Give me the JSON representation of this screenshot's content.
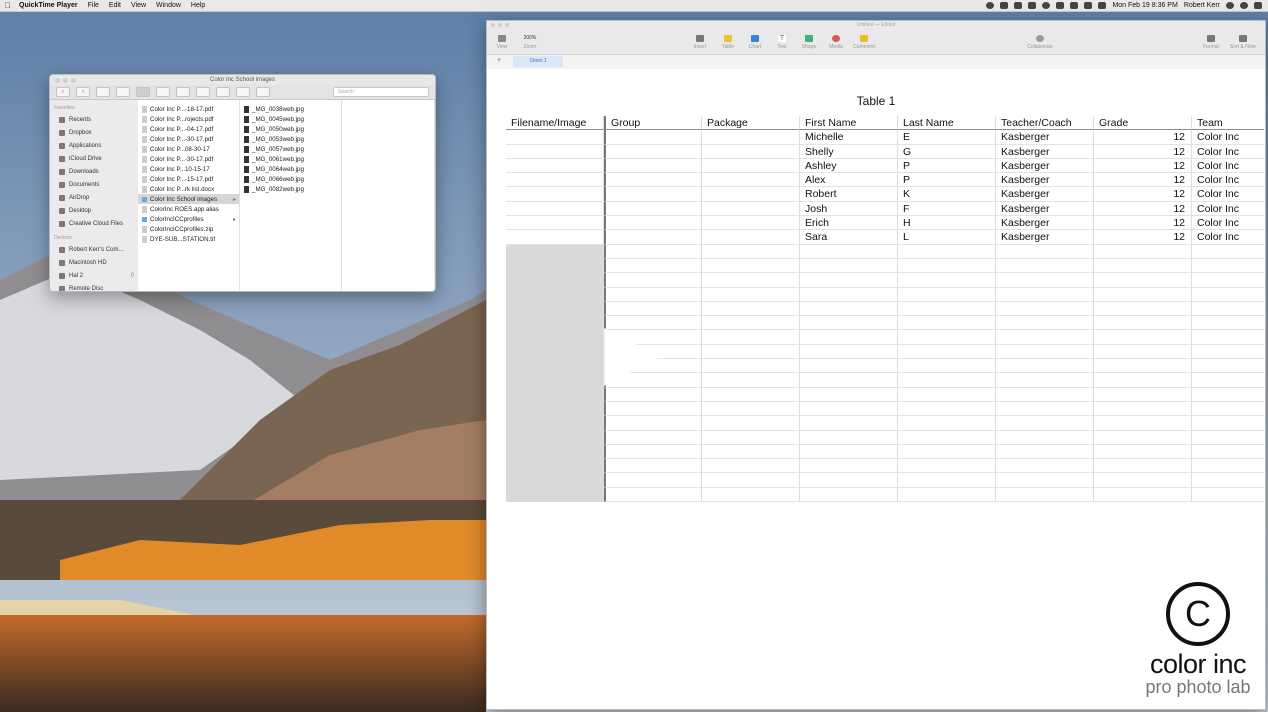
{
  "menubar": {
    "app": "QuickTime Player",
    "items": [
      "File",
      "Edit",
      "View",
      "Window",
      "Help"
    ],
    "datetime": "Mon Feb 19  8:36 PM",
    "user": "Robert Kerr"
  },
  "finder": {
    "title": "Color Inc School images",
    "search_placeholder": "Search",
    "sidebar": {
      "favorites_header": "Favorites",
      "favorites": [
        "Recents",
        "Dropbox",
        "Applications",
        "iCloud Drive",
        "Downloads",
        "Documents",
        "AirDrop",
        "Desktop",
        "Creative Cloud Files"
      ],
      "devices_header": "Devices",
      "devices": [
        "Robert Kerr's Com...",
        "Macintosh HD",
        "Hal 2",
        "Remote Disc"
      ],
      "device_badge": "0"
    },
    "column1": [
      "Color Inc P...-18-17.pdf",
      "Color Inc P...rojects.pdf",
      "Color Inc P...-04-17.pdf",
      "Color Inc P...-30-17.pdf",
      "Color Inc P...08-30-17",
      "Color Inc P...-30-17.pdf",
      "Color Inc P...10-15-17",
      "Color Inc P...-15-17.pdf",
      "Color Inc P...rk list.docx",
      "Color Inc School images",
      "ColorInc ROES.app alias",
      "ColorIncICCprofiles",
      "ColorIncICCprofiles.zip",
      "DYE-SUB...STATION.tif"
    ],
    "column2": [
      "_MG_0038web.jpg",
      "_MG_0045web.jpg",
      "_MG_0050web.jpg",
      "_MG_0053web.jpg",
      "_MG_0057web.jpg",
      "_MG_0061web.jpg",
      "_MG_0064web.jpg",
      "_MG_0066web.jpg",
      "_MG_0082web.jpg"
    ]
  },
  "numbers": {
    "window_title": "Untitled — Edited",
    "toolbar": {
      "view": "View",
      "zoom_value": "200%",
      "zoom": "Zoom",
      "insert": "Insert",
      "table": "Table",
      "chart": "Chart",
      "text": "Text",
      "shape": "Shape",
      "media": "Media",
      "comment": "Comment",
      "collaborate": "Collaborate",
      "format": "Format",
      "sort_filter": "Sort & Filter"
    },
    "sheet_tab": "Sheet 1",
    "table_title": "Table 1",
    "headers": [
      "Filename/Image",
      "Group",
      "Package",
      "First Name",
      "Last Name",
      "Teacher/Coach",
      "Grade",
      "Team"
    ],
    "rows": [
      [
        "",
        "",
        "",
        "Michelle",
        "E",
        "Kasberger",
        "12",
        "Color Inc"
      ],
      [
        "",
        "",
        "",
        "Shelly",
        "G",
        "Kasberger",
        "12",
        "Color Inc"
      ],
      [
        "",
        "",
        "",
        "Ashley",
        "P",
        "Kasberger",
        "12",
        "Color Inc"
      ],
      [
        "",
        "",
        "",
        "Alex",
        "P",
        "Kasberger",
        "12",
        "Color Inc"
      ],
      [
        "",
        "",
        "",
        "Robert",
        "K",
        "Kasberger",
        "12",
        "Color Inc"
      ],
      [
        "",
        "",
        "",
        "Josh",
        "F",
        "Kasberger",
        "12",
        "Color Inc"
      ],
      [
        "",
        "",
        "",
        "Erich",
        "H",
        "Kasberger",
        "12",
        "Color Inc"
      ],
      [
        "",
        "",
        "",
        "Sara",
        "L",
        "Kasberger",
        "12",
        "Color Inc"
      ]
    ],
    "empty_rows": 18
  },
  "watermark": {
    "symbol": "C",
    "brand": "color inc",
    "tagline": "pro photo lab"
  },
  "colors": {
    "accent": "#3d7ad6",
    "selection_gray": "#d9d9d9",
    "sheet_tab_bg": "#d9e7f7"
  }
}
